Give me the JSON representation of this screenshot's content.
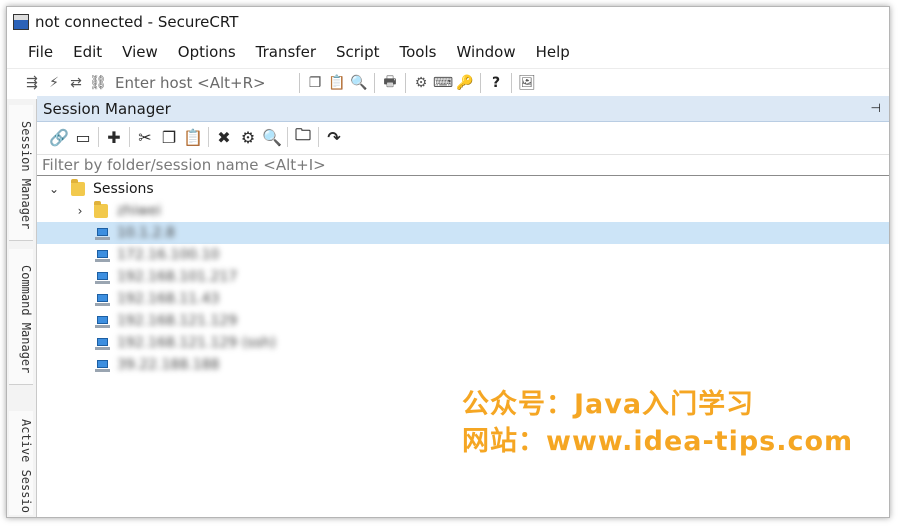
{
  "window": {
    "title": "not connected - SecureCRT"
  },
  "menu": [
    "File",
    "Edit",
    "View",
    "Options",
    "Transfer",
    "Script",
    "Tools",
    "Window",
    "Help"
  ],
  "toolbar": {
    "host_placeholder": "Enter host <Alt+R>"
  },
  "side_tabs": [
    "Session Manager",
    "Command Manager",
    "Active Sessio"
  ],
  "session_manager": {
    "title": "Session Manager",
    "filter_placeholder": "Filter by folder/session name <Alt+I>",
    "tree": [
      {
        "kind": "folder-root",
        "label": "Sessions",
        "expanded": true
      },
      {
        "kind": "folder",
        "label": "zhiwei",
        "expanded": false
      },
      {
        "kind": "session",
        "label": "10.1.2.8",
        "selected": true
      },
      {
        "kind": "session",
        "label": "172.16.100.10"
      },
      {
        "kind": "session",
        "label": "192.168.101.217"
      },
      {
        "kind": "session",
        "label": "192.168.11.43"
      },
      {
        "kind": "session",
        "label": "192.168.121.129"
      },
      {
        "kind": "session",
        "label": "192.168.121.129 (ssh)"
      },
      {
        "kind": "session",
        "label": "39.22.188.188"
      }
    ]
  },
  "watermark": {
    "line1": "公众号：Java入门学习",
    "line2": "网站：www.idea-tips.com",
    "color": "#f5a623"
  },
  "colors": {
    "panel_header": "#dce8f5",
    "selected_row": "#cce4f7"
  }
}
